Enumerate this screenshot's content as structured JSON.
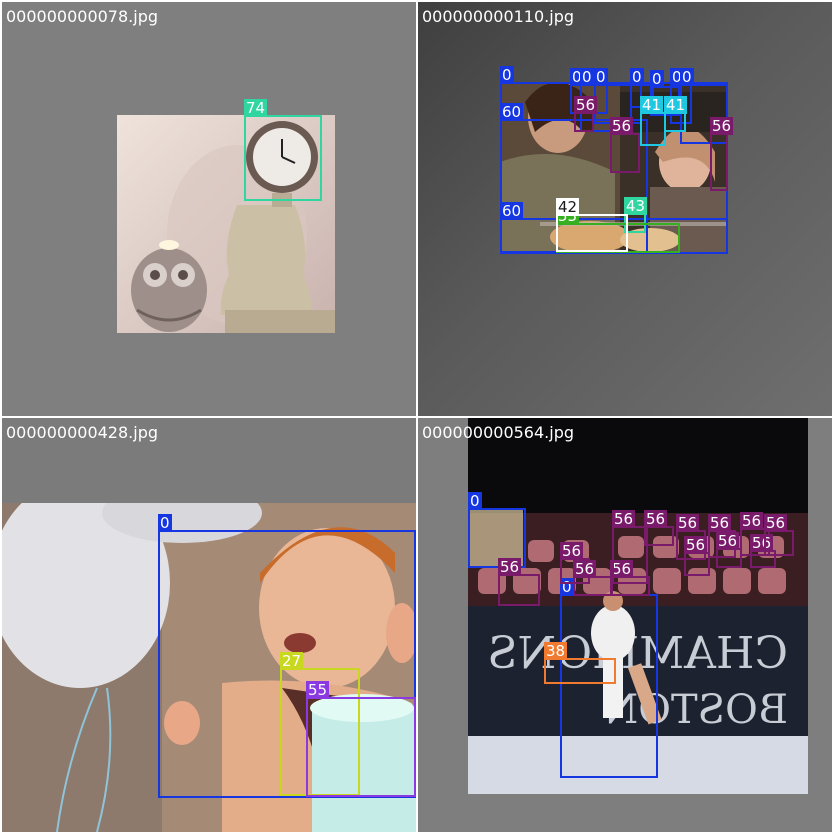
{
  "tiles": [
    {
      "filename": "000000000078.jpg",
      "detections": [
        {
          "label": "74",
          "color": "#2fd6a0"
        }
      ]
    },
    {
      "filename": "000000000110.jpg",
      "detections": [
        {
          "label": "0",
          "color": "#1536e0"
        },
        {
          "label": "60",
          "color": "#1536e0"
        },
        {
          "label": "60",
          "color": "#1536e0"
        },
        {
          "label": "0",
          "color": "#1536e0"
        },
        {
          "label": "0",
          "color": "#1536e0"
        },
        {
          "label": "0",
          "color": "#1536e0"
        },
        {
          "label": "0",
          "color": "#1536e0"
        },
        {
          "label": "0",
          "color": "#1536e0"
        },
        {
          "label": "0",
          "color": "#1536e0"
        },
        {
          "label": "0",
          "color": "#1536e0"
        },
        {
          "label": "56",
          "color": "#7a1a6a"
        },
        {
          "label": "56",
          "color": "#7a1a6a"
        },
        {
          "label": "56",
          "color": "#7a1a6a"
        },
        {
          "label": "41",
          "color": "#1ec8e0"
        },
        {
          "label": "41",
          "color": "#1ec8e0"
        },
        {
          "label": "43",
          "color": "#2fd6a0"
        },
        {
          "label": "53",
          "color": "#36b020"
        },
        {
          "label": "42",
          "color": "#ffffff"
        }
      ]
    },
    {
      "filename": "000000000428.jpg",
      "detections": [
        {
          "label": "0",
          "color": "#1536e0"
        },
        {
          "label": "27",
          "color": "#c8d81e"
        },
        {
          "label": "55",
          "color": "#8a3ae0"
        }
      ]
    },
    {
      "filename": "000000000564.jpg",
      "detections": [
        {
          "label": "0",
          "color": "#1536e0"
        },
        {
          "label": "0",
          "color": "#1536e0"
        },
        {
          "label": "38",
          "color": "#f07a30"
        },
        {
          "label": "56",
          "color": "#7a1a6a"
        },
        {
          "label": "56",
          "color": "#7a1a6a"
        },
        {
          "label": "56",
          "color": "#7a1a6a"
        },
        {
          "label": "56",
          "color": "#7a1a6a"
        },
        {
          "label": "56",
          "color": "#7a1a6a"
        },
        {
          "label": "56",
          "color": "#7a1a6a"
        },
        {
          "label": "56",
          "color": "#7a1a6a"
        },
        {
          "label": "56",
          "color": "#7a1a6a"
        },
        {
          "label": "56",
          "color": "#7a1a6a"
        },
        {
          "label": "56",
          "color": "#7a1a6a"
        },
        {
          "label": "56",
          "color": "#7a1a6a"
        },
        {
          "label": "56",
          "color": "#7a1a6a"
        },
        {
          "label": "56",
          "color": "#7a1a6a"
        }
      ]
    }
  ]
}
